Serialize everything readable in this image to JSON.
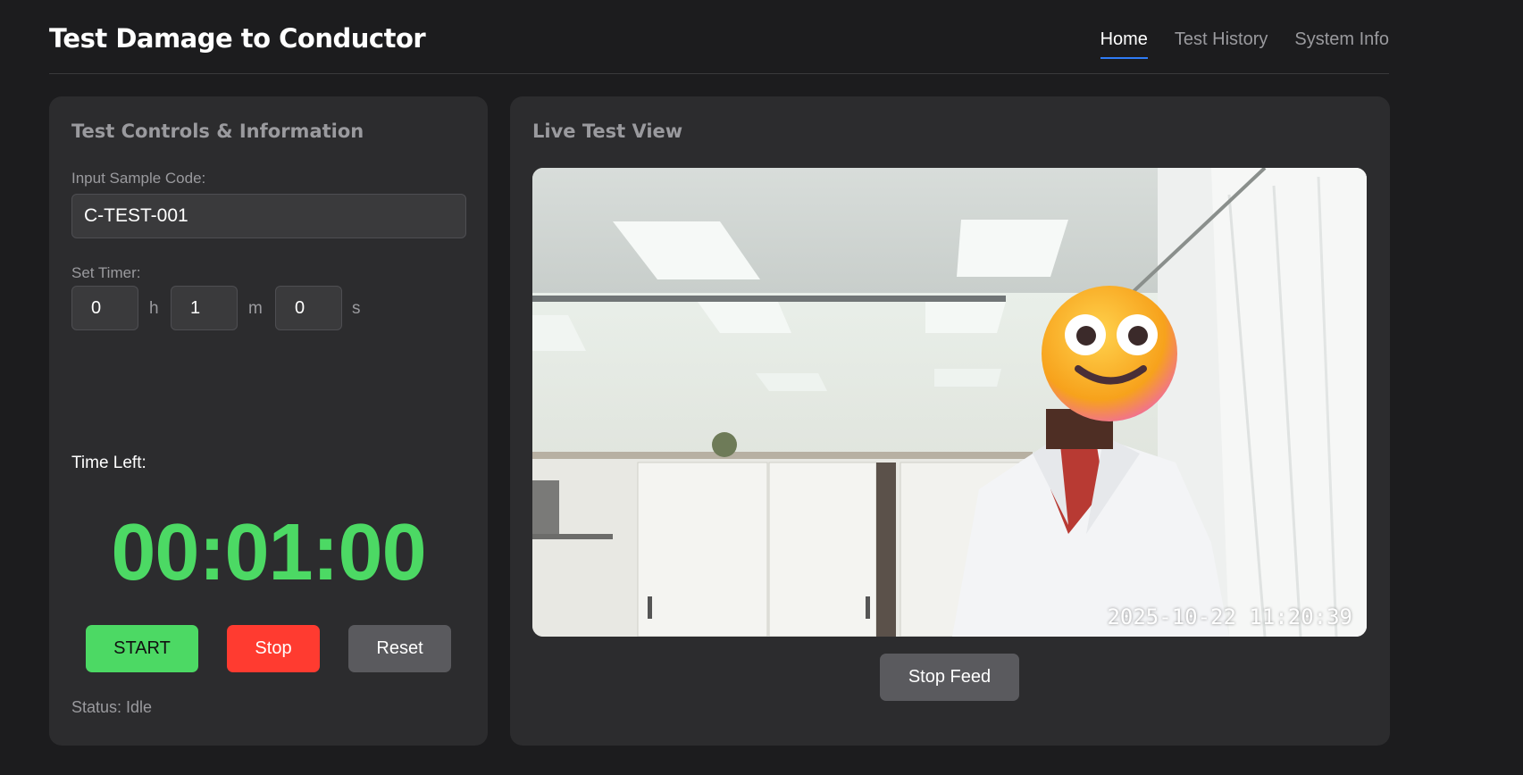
{
  "header": {
    "title": "Test Damage to Conductor",
    "nav": [
      "Home",
      "Test History",
      "System Info"
    ],
    "active_nav": "Home"
  },
  "controls": {
    "title": "Test Controls & Information",
    "sample_label": "Input Sample Code:",
    "sample_value": "C-TEST-001",
    "timer_label": "Set Timer:",
    "hours": "0",
    "hours_unit": "h",
    "minutes": "1",
    "minutes_unit": "m",
    "seconds": "0",
    "seconds_unit": "s",
    "time_left_label": "Time Left:",
    "time_left": "00:01:00",
    "start_label": "START",
    "stop_label": "Stop",
    "reset_label": "Reset",
    "status": "Status: Idle"
  },
  "live": {
    "title": "Live Test View",
    "timestamp": "2025-10-22  11:20:39",
    "stop_feed_label": "Stop Feed"
  },
  "colors": {
    "background": "#1c1c1e",
    "panel": "#2c2c2e",
    "accent_green": "#4cd964",
    "accent_red": "#ff3b30",
    "nav_active_underline": "#2f7cf6"
  },
  "icons": {
    "face_cover": "smiling-face-emoji"
  }
}
